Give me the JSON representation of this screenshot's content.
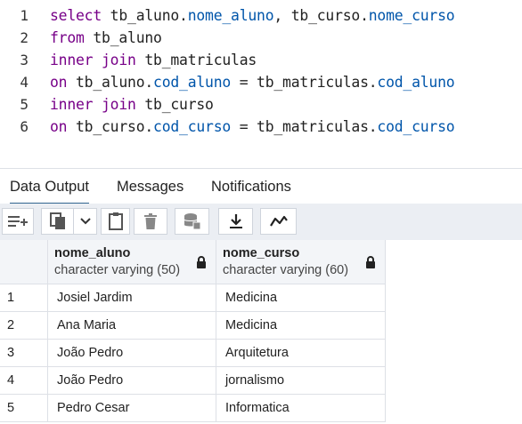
{
  "editor": {
    "lines": [
      {
        "num": "1",
        "tokens": [
          {
            "t": "select",
            "c": "kw"
          },
          {
            "t": " tb_aluno.",
            "c": ""
          },
          {
            "t": "nome_aluno",
            "c": "prop"
          },
          {
            "t": ", tb_curso.",
            "c": ""
          },
          {
            "t": "nome_curso",
            "c": "prop"
          }
        ]
      },
      {
        "num": "2",
        "tokens": [
          {
            "t": "from",
            "c": "kw"
          },
          {
            "t": " tb_aluno",
            "c": ""
          }
        ]
      },
      {
        "num": "3",
        "tokens": [
          {
            "t": "inner join",
            "c": "kw"
          },
          {
            "t": " tb_matriculas",
            "c": ""
          }
        ]
      },
      {
        "num": "4",
        "tokens": [
          {
            "t": "on",
            "c": "kw"
          },
          {
            "t": " tb_aluno.",
            "c": ""
          },
          {
            "t": "cod_aluno",
            "c": "prop"
          },
          {
            "t": " = tb_matriculas.",
            "c": ""
          },
          {
            "t": "cod_aluno",
            "c": "prop"
          }
        ]
      },
      {
        "num": "5",
        "tokens": [
          {
            "t": "inner join",
            "c": "kw"
          },
          {
            "t": " tb_curso",
            "c": ""
          }
        ]
      },
      {
        "num": "6",
        "tokens": [
          {
            "t": "on",
            "c": "kw"
          },
          {
            "t": " tb_curso.",
            "c": ""
          },
          {
            "t": "cod_curso",
            "c": "prop"
          },
          {
            "t": " = tb_matriculas.",
            "c": ""
          },
          {
            "t": "cod_curso",
            "c": "prop"
          }
        ]
      }
    ]
  },
  "tabs": [
    {
      "label": "Data Output",
      "active": true
    },
    {
      "label": "Messages",
      "active": false
    },
    {
      "label": "Notifications",
      "active": false
    }
  ],
  "toolbar": {
    "icons": [
      "add-row-icon",
      "copy-icon",
      "chevron-down-icon",
      "paste-icon",
      "delete-icon",
      "save-data-icon",
      "download-icon",
      "graph-visualiser-icon"
    ]
  },
  "grid": {
    "columns": [
      {
        "name": "nome_aluno",
        "type": "character varying (50)"
      },
      {
        "name": "nome_curso",
        "type": "character varying (60)"
      }
    ],
    "rows": [
      {
        "n": "1",
        "cells": [
          "Josiel Jardim",
          "Medicina"
        ]
      },
      {
        "n": "2",
        "cells": [
          "Ana Maria",
          "Medicina"
        ]
      },
      {
        "n": "3",
        "cells": [
          "João Pedro",
          "Arquitetura"
        ]
      },
      {
        "n": "4",
        "cells": [
          "João Pedro",
          "jornalismo"
        ]
      },
      {
        "n": "5",
        "cells": [
          "Pedro Cesar",
          "Informatica"
        ]
      }
    ]
  },
  "colors": {
    "keyword": "#770088",
    "property": "#0055aa",
    "tab_accent": "#326690"
  }
}
